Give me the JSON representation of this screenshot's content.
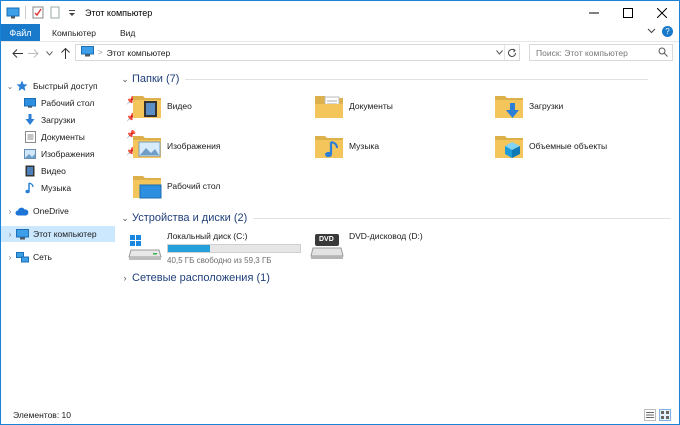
{
  "window": {
    "title": "Этот компьютер"
  },
  "ribbon": {
    "tabs": [
      "Файл",
      "Компьютер",
      "Вид"
    ],
    "help": "?"
  },
  "address": {
    "path": "Этот компьютер"
  },
  "search": {
    "placeholder": "Поиск: Этот компьютер"
  },
  "nav": {
    "quick_access": "Быстрый доступ",
    "quick_items": [
      "Рабочий стол",
      "Загрузки",
      "Документы",
      "Изображения",
      "Видео",
      "Музыка"
    ],
    "onedrive": "OneDrive",
    "this_pc": "Этот компьютер",
    "network": "Сеть"
  },
  "groups": {
    "folders": "Папки (7)",
    "devices": "Устройства и диски (2)",
    "network": "Сетевые расположения (1)"
  },
  "folders": [
    "Видео",
    "Документы",
    "Загрузки",
    "Изображения",
    "Музыка",
    "Объемные объекты",
    "Рабочий стол"
  ],
  "drives": [
    {
      "name": "Локальный диск (C:)",
      "free_text": "40,5 ГБ свободно из 59,3 ГБ",
      "used_fraction": 0.317
    },
    {
      "name": "DVD-дисковод (D:)",
      "badge": "DVD"
    }
  ],
  "status": {
    "items": "Элементов: 10"
  },
  "colors": {
    "accent": "#1979ca",
    "selection": "#cce8ff",
    "group_title": "#1f3f7a",
    "folder": "#f4c55a",
    "drive_bar": "#26a0da"
  }
}
